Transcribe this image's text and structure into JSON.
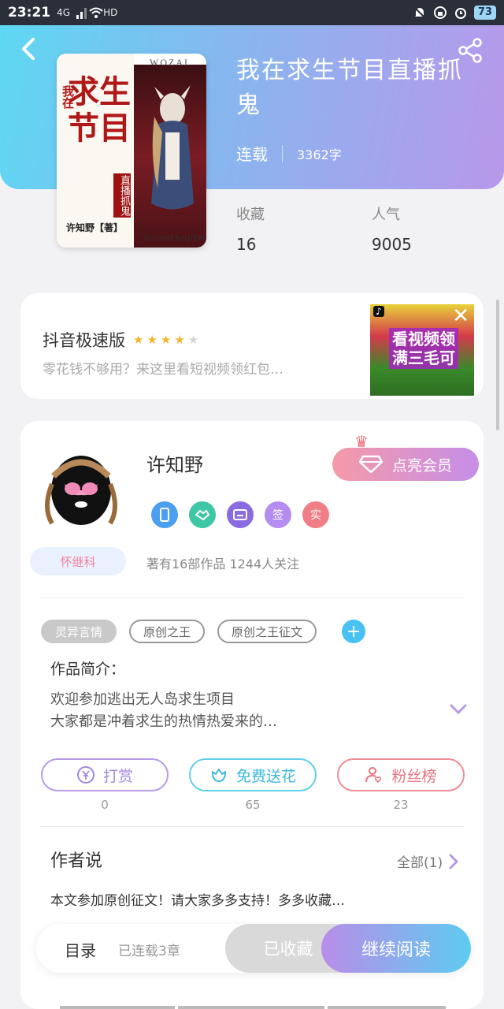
{
  "status_bar": {
    "time": "23:21",
    "network": "4G",
    "wifi_label": "HD",
    "battery": "73"
  },
  "book": {
    "title": "我在求生节目直播抓鬼",
    "status": "连载",
    "word_count": "3362字",
    "favorites_label": "收藏",
    "favorites_value": "16",
    "popularity_label": "人气",
    "popularity_value": "9005"
  },
  "cover": {
    "top_text": "WOZAI",
    "small_title": "我在",
    "big_title": "求生节目",
    "subtitle": "直播抓鬼",
    "author_tag": "许知野【著】",
    "pinyin": "QIUSHENGJIEMU"
  },
  "ad": {
    "app_name": "抖音极速版",
    "rating_stars": 4,
    "rating_max": 5,
    "description": "零花钱不够用？来这里看短视频领红包…",
    "banner_line1": "看视频领",
    "banner_line2": "满三毛可",
    "close_symbol": "✕",
    "logo_text": "♪"
  },
  "author": {
    "name": "许知野",
    "vip_button": "点亮会员",
    "fan_title": "怀继科",
    "works_info": "著有16部作品 1244人关注",
    "badges": [
      {
        "icon": "phone-badge-icon",
        "label": "",
        "color": "#4c9ef0"
      },
      {
        "icon": "handshake-badge-icon",
        "label": "",
        "color": "#3ec7a6"
      },
      {
        "icon": "card-badge-icon",
        "label": "",
        "color": "#8b6be0"
      },
      {
        "icon": "sign-badge-icon",
        "label": "签",
        "color": "#b38df0"
      },
      {
        "icon": "verified-badge-icon",
        "label": "实",
        "color": "#f07e86"
      }
    ]
  },
  "tags": [
    "灵异言情",
    "原创之王",
    "原创之王征文"
  ],
  "intro": {
    "label": "作品简介：",
    "line1": "欢迎参加逃出无人岛求生项目",
    "line2": "大家都是冲着求生的热情热爱来的…"
  },
  "actions": [
    {
      "label": "打赏",
      "count": "0"
    },
    {
      "label": "免费送花",
      "count": "65"
    },
    {
      "label": "粉丝榜",
      "count": "23"
    }
  ],
  "author_says": {
    "title": "作者说",
    "all_label": "全部(1)",
    "text": "本文参加原创征文！请大家多多支持！多多收藏…"
  },
  "bottom_bar": {
    "toc": "目录",
    "chapters": "已连载3章",
    "favorited": "已收藏",
    "continue_reading": "继续阅读"
  },
  "colors": {
    "header_gradient_start": "#5ed8f3",
    "header_gradient_end": "#b898ea",
    "accent_purple": "#b98de8",
    "accent_cyan": "#5ecbf0"
  }
}
